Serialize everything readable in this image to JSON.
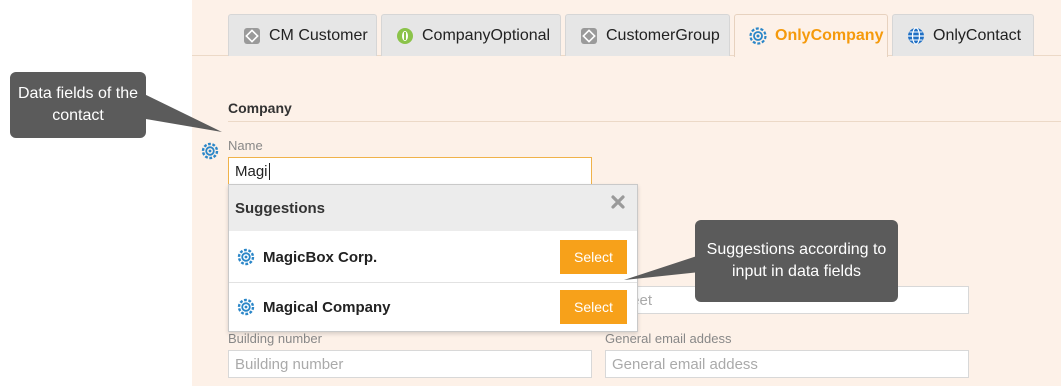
{
  "tabs": [
    {
      "label": "CM Customer",
      "icon": "customer-icon"
    },
    {
      "label": "CompanyOptional",
      "icon": "company-optional-icon"
    },
    {
      "label": "CustomerGroup",
      "icon": "customer-group-icon"
    },
    {
      "label": "OnlyCompany",
      "icon": "gear-icon",
      "active": true
    },
    {
      "label": "OnlyContact",
      "icon": "globe-icon"
    }
  ],
  "section": {
    "title": "Company"
  },
  "fields": {
    "name": {
      "label": "Name",
      "value": "Magi"
    },
    "street": {
      "placeholder": "Street"
    },
    "building_number": {
      "label": "Building number",
      "placeholder": "Building number"
    },
    "general_email": {
      "label": "General email addess",
      "placeholder": "General email addess"
    }
  },
  "suggestions": {
    "title": "Suggestions",
    "items": [
      {
        "label": "MagicBox Corp.",
        "button": "Select"
      },
      {
        "label": "Magical Company",
        "button": "Select"
      }
    ]
  },
  "callouts": {
    "left": "Data fields of the contact",
    "right": "Suggestions according to input in data fields"
  },
  "colors": {
    "accent": "#f59a0c",
    "button": "#f7a11a",
    "callout": "#5b5b5b",
    "page": "#fdf1e8"
  }
}
